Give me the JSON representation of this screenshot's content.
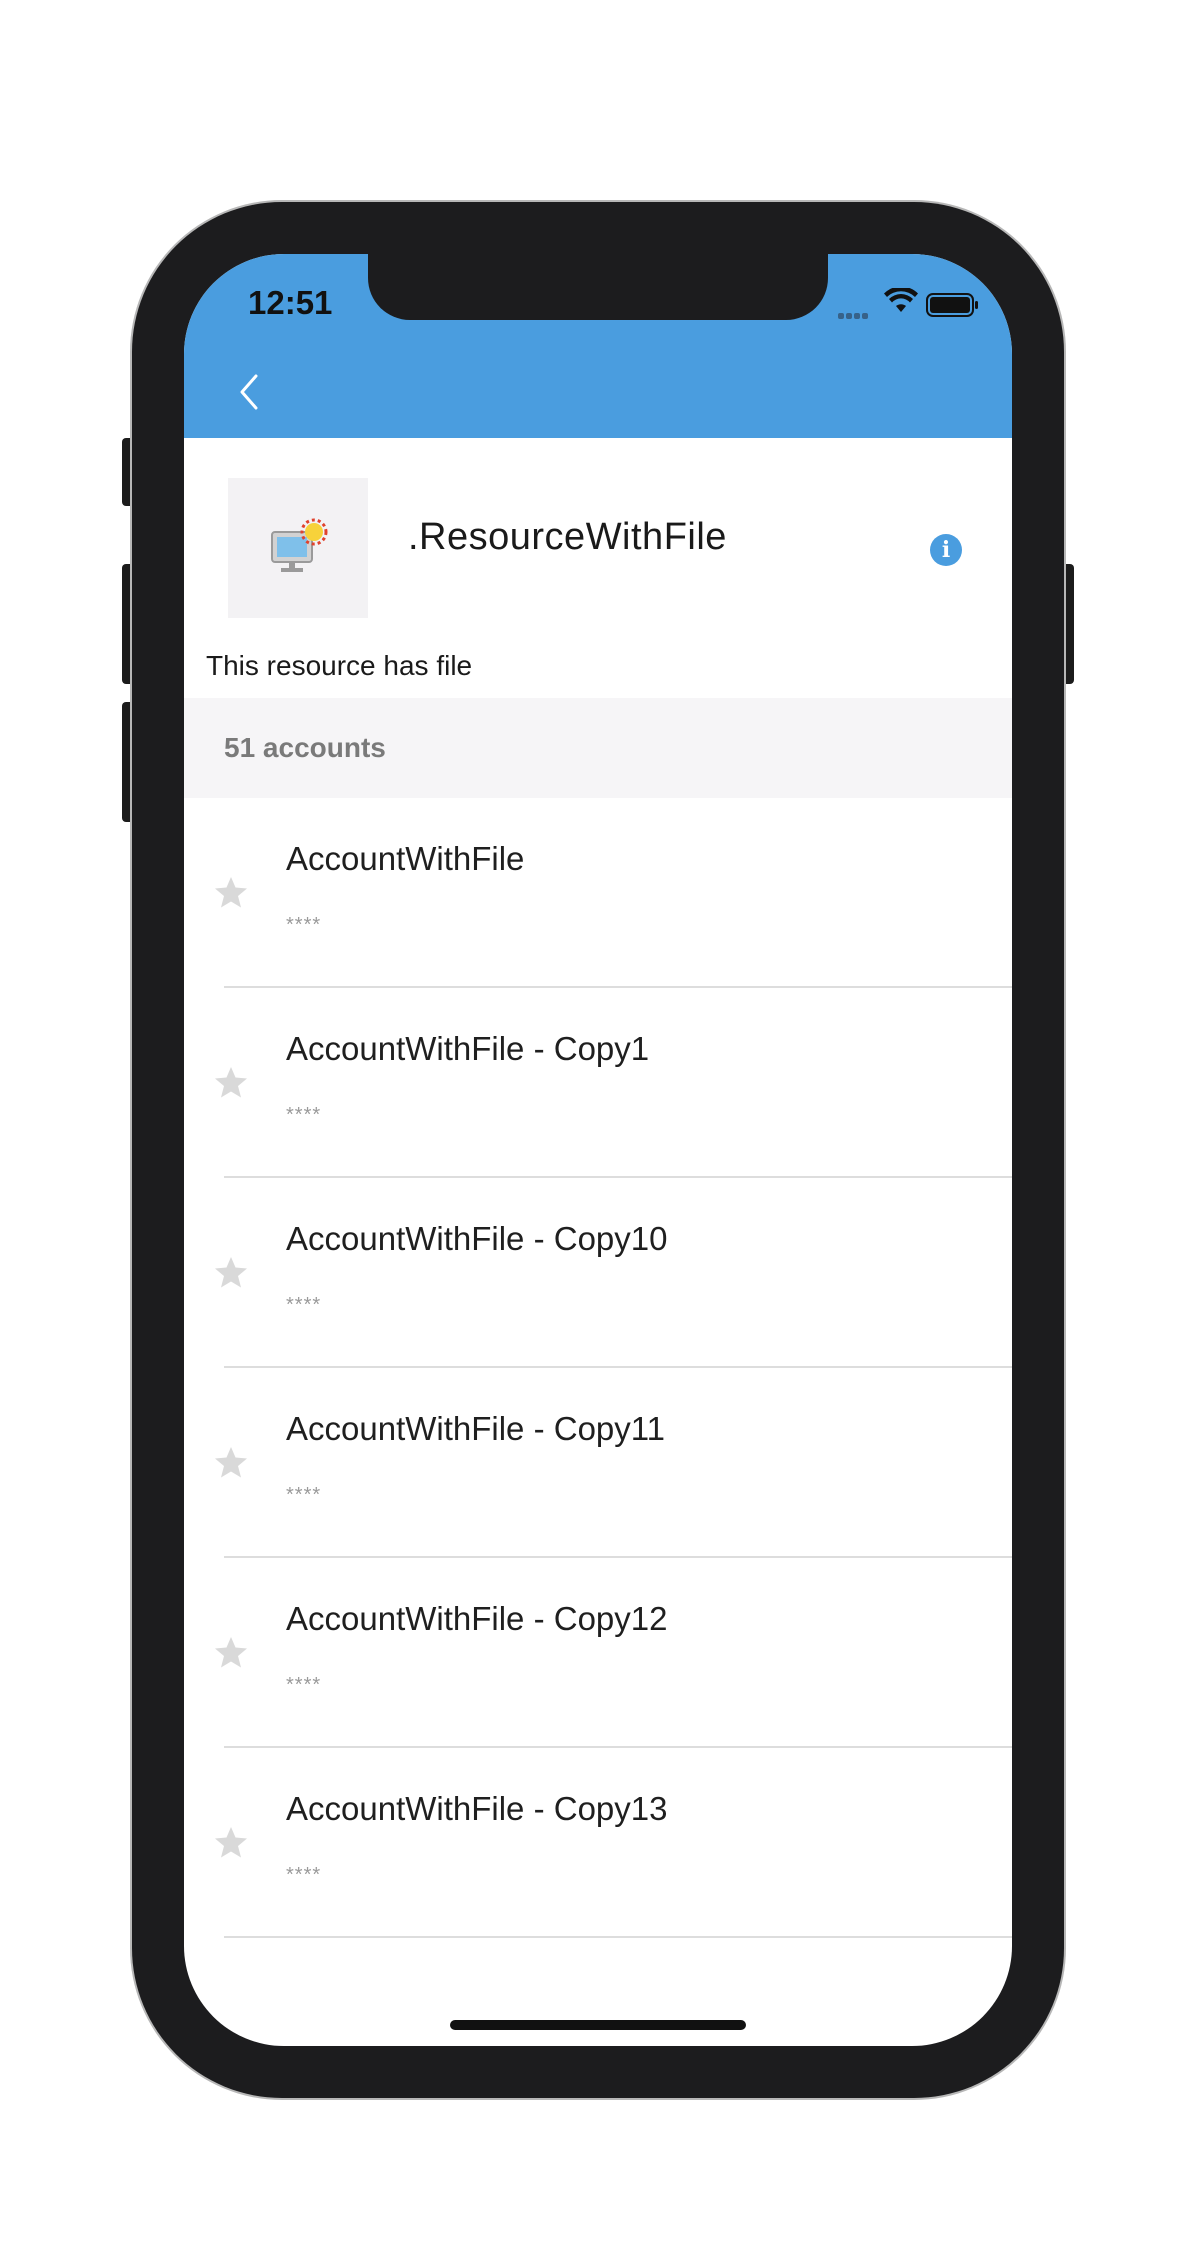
{
  "status_bar": {
    "time": "12:51"
  },
  "nav": {
    "back_icon": "chevron-left-icon"
  },
  "resource": {
    "icon": "computer-with-sun-icon",
    "title": ".ResourceWithFile",
    "description": "This resource has file",
    "info_icon_glyph": "i"
  },
  "accounts_header": {
    "label": "51 accounts"
  },
  "accounts": [
    {
      "name": "AccountWithFile",
      "password": "****",
      "favorite": false
    },
    {
      "name": "AccountWithFile - Copy1",
      "password": "****",
      "favorite": false
    },
    {
      "name": "AccountWithFile - Copy10",
      "password": "****",
      "favorite": false
    },
    {
      "name": "AccountWithFile - Copy11",
      "password": "****",
      "favorite": false
    },
    {
      "name": "AccountWithFile - Copy12",
      "password": "****",
      "favorite": false
    },
    {
      "name": "AccountWithFile - Copy13",
      "password": "****",
      "favorite": false
    }
  ],
  "colors": {
    "header": "#4a9ddf",
    "star": "#d9d9d9",
    "section_bg": "#f6f5f7"
  }
}
